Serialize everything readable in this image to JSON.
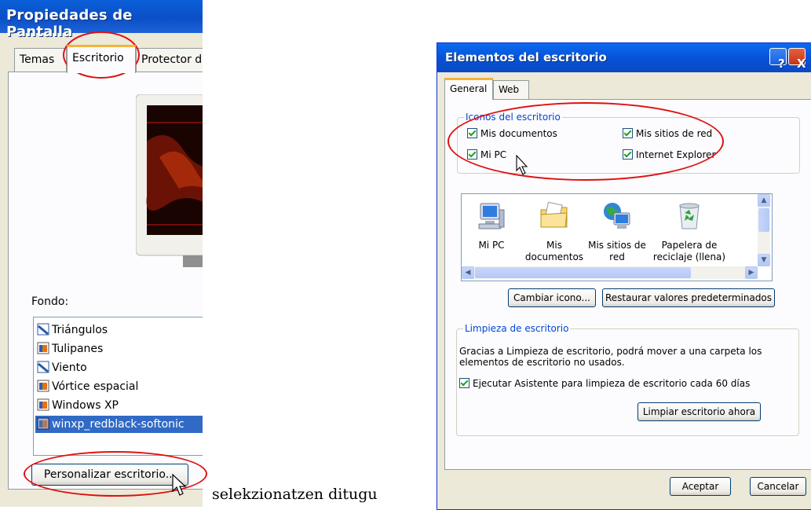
{
  "left_dialog": {
    "title": "Propiedades de Pantalla",
    "tabs": [
      "Temas",
      "Escritorio",
      "Protector d"
    ],
    "active_tab": "Escritorio",
    "background_label": "Fondo:",
    "wallpapers": [
      {
        "name": "Triángulos",
        "icon": "image-file-icon"
      },
      {
        "name": "Tulipanes",
        "icon": "jpeg-file-icon"
      },
      {
        "name": "Viento",
        "icon": "image-file-icon"
      },
      {
        "name": "Vórtice espacial",
        "icon": "jpeg-file-icon"
      },
      {
        "name": "Windows XP",
        "icon": "jpeg-file-icon"
      },
      {
        "name": "winxp_redblack-softonic",
        "icon": "jpeg-file-icon",
        "selected": true
      }
    ],
    "customize_button": "Personalizar escritorio..."
  },
  "caption": "selekzionatzen ditugu",
  "right_dialog": {
    "title": "Elementos del escritorio",
    "help_button": "?",
    "close_button": "X",
    "tabs": [
      "General",
      "Web"
    ],
    "active_tab": "General",
    "desktop_icons_group": {
      "label": "Iconos del escritorio",
      "checkboxes": [
        {
          "label": "Mis documentos",
          "checked": true
        },
        {
          "label": "Mis sitios de red",
          "checked": true
        },
        {
          "label": "Mi PC",
          "checked": true
        },
        {
          "label": "Internet Explorer",
          "checked": true
        }
      ]
    },
    "icons": [
      {
        "line1": "Mi PC",
        "line2": "",
        "icon": "my-computer-icon"
      },
      {
        "line1": "Mis",
        "line2": "documentos",
        "icon": "my-documents-icon"
      },
      {
        "line1": "Mis sitios de",
        "line2": "red",
        "icon": "network-places-icon"
      },
      {
        "line1": "Papelera de",
        "line2": "reciclaje (llena)",
        "icon": "recycle-bin-full-icon"
      }
    ],
    "change_icon_button": "Cambiar icono...",
    "restore_defaults_button": "Restaurar valores predeterminados",
    "cleanup_group": {
      "label": "Limpieza de escritorio",
      "description_line1": "Gracias a Limpieza de escritorio, podrá mover a una carpeta los",
      "description_line2": "elementos de escritorio no usados.",
      "checkbox": {
        "label": "Ejecutar Asistente para limpieza de escritorio cada 60 días",
        "checked": true
      },
      "clean_now_button": "Limpiar escritorio ahora"
    },
    "ok_button": "Aceptar",
    "cancel_button": "Cancelar"
  },
  "colors": {
    "xp_title_blue": "#0b4fc7",
    "annotation_red": "#e01010",
    "selection_blue": "#316ac5",
    "dialog_bg": "#ece9d8"
  }
}
